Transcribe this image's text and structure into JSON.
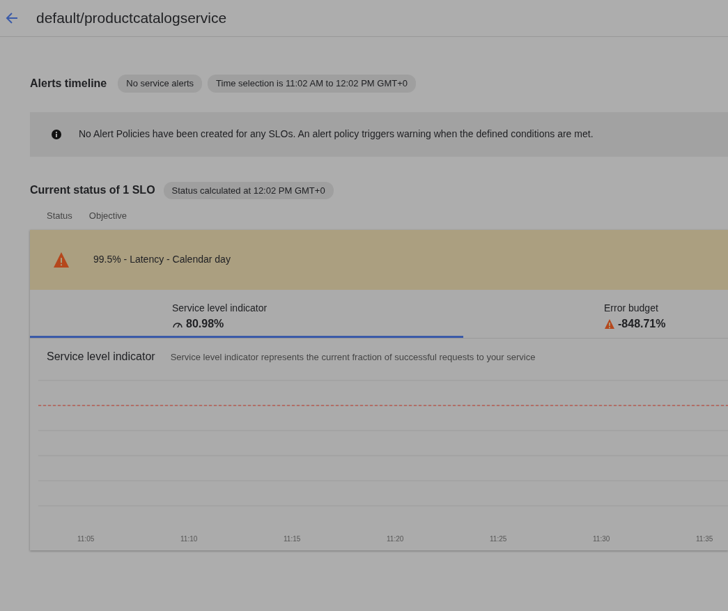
{
  "header": {
    "title": "default/productcatalogservice"
  },
  "alerts_timeline": {
    "title": "Alerts timeline",
    "chips": [
      "No service alerts",
      "Time selection is 11:02 AM to 12:02 PM GMT+0"
    ]
  },
  "info_banner": {
    "text": "No Alert Policies have been created for any SLOs. An alert policy triggers warning when the defined conditions are met."
  },
  "current_status": {
    "title": "Current status of 1 SLO",
    "chip": "Status calculated at 12:02 PM GMT+0",
    "columns": [
      "Status",
      "Objective"
    ]
  },
  "slo": {
    "warning": true,
    "objective": "99.5% - Latency - Calendar day"
  },
  "tabs": [
    {
      "label": "Service level indicator",
      "value": "80.98%",
      "kind": "gauge",
      "selected": true
    },
    {
      "label": "Error budget",
      "value": "-848.71%",
      "kind": "warning",
      "selected": false
    }
  ],
  "panel": {
    "title": "Service level indicator",
    "description": "Service level indicator represents the current fraction of successful requests to your service",
    "x_axis_labels": [
      "11:05",
      "11:10",
      "11:15",
      "11:20",
      "11:25",
      "11:30",
      "11:35"
    ]
  }
}
